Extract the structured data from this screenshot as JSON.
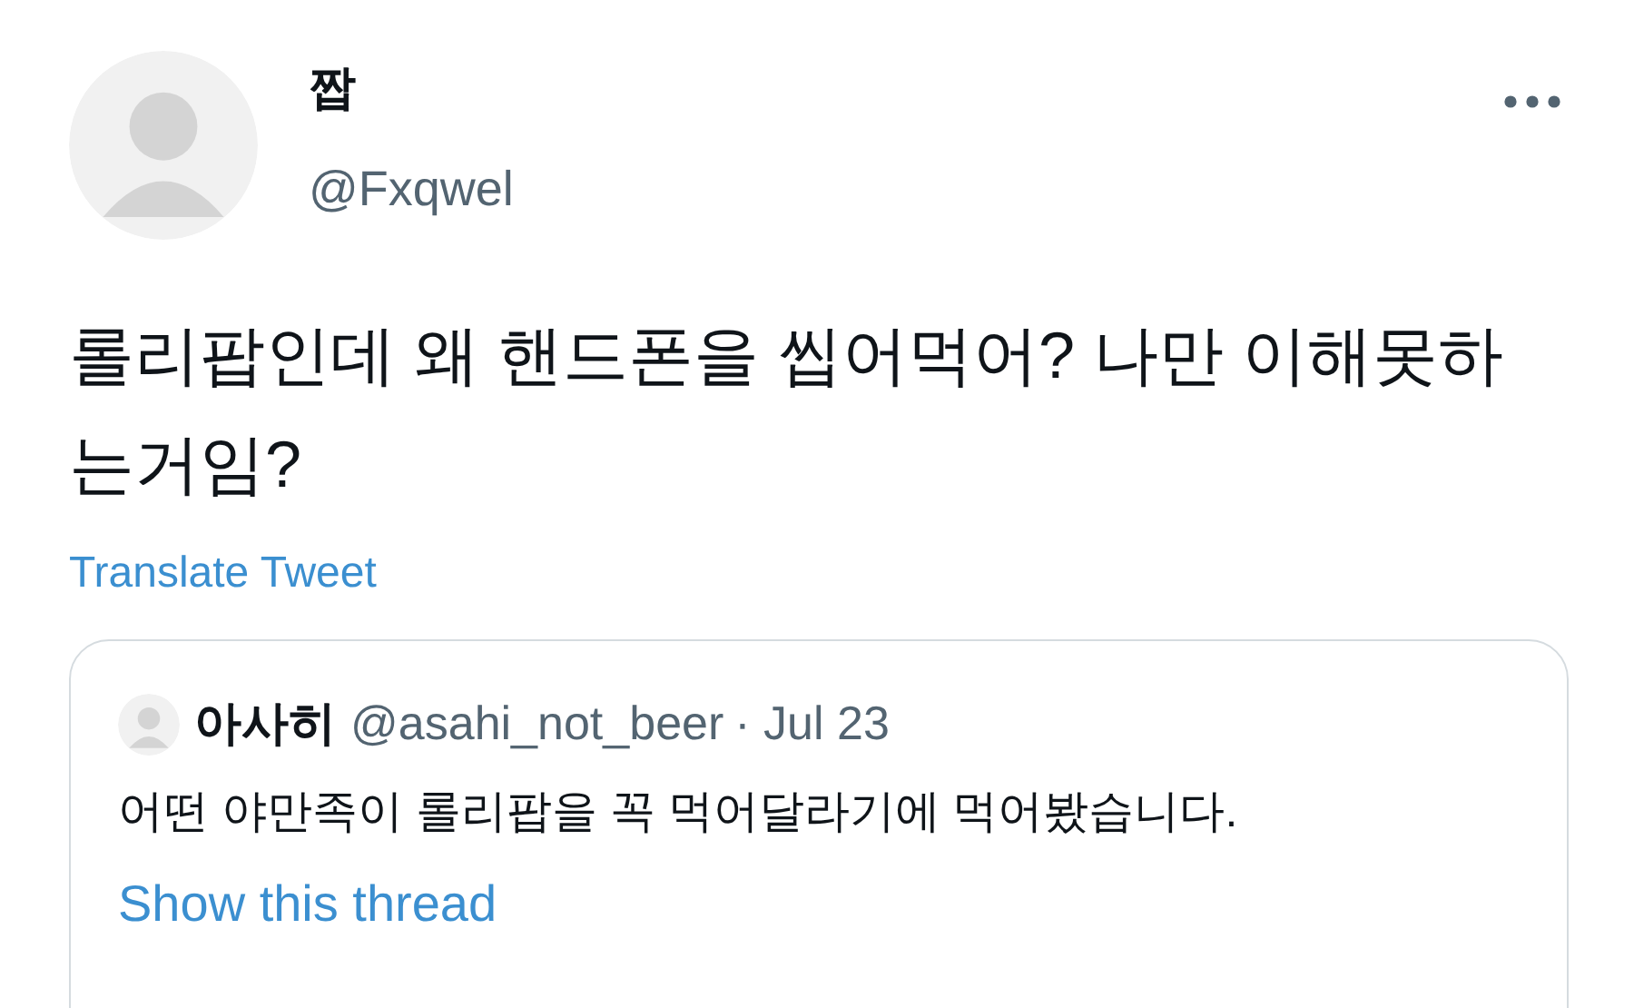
{
  "tweet": {
    "author": {
      "name": "짭",
      "handle": "@Fxqwel"
    },
    "text": "롤리팝인데 왜 핸드폰을 씹어먹어? 나만 이해못하는거임?",
    "translate_link": "Translate Tweet",
    "quoted_tweet": {
      "author": {
        "name": "아사히",
        "handle": "@asahi_not_beer"
      },
      "date": "· Jul 23",
      "text": "어떤 야만족이 롤리팝을 꼭 먹어달라기에 먹어봤습니다.",
      "thread_link": "Show this thread"
    }
  }
}
